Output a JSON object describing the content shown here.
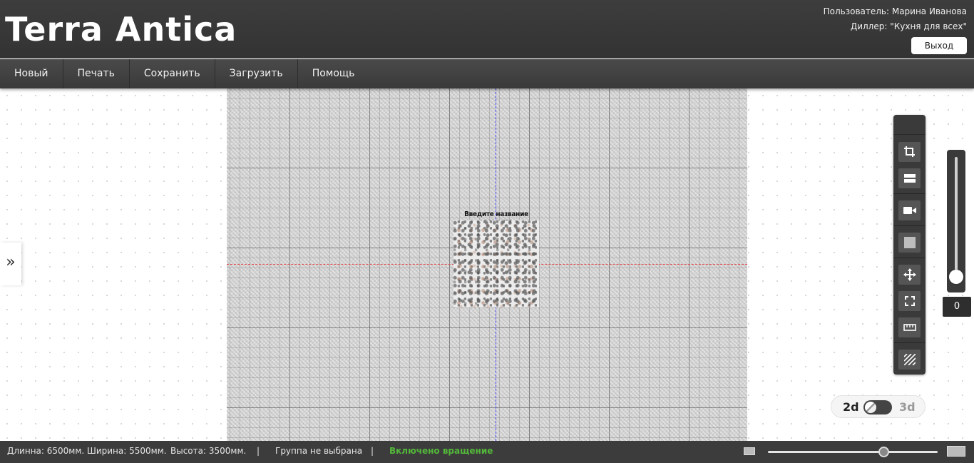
{
  "header": {
    "logo": "Terra Antica",
    "user_line": "Пользователь: Марина Иванова",
    "dealer_line": "Диллер: \"Кухня для всех\"",
    "logout_label": "Выход"
  },
  "menu": {
    "items": [
      {
        "label": "Новый"
      },
      {
        "label": "Печать"
      },
      {
        "label": "Сохранить"
      },
      {
        "label": "Загрузить"
      },
      {
        "label": "Помощь"
      }
    ]
  },
  "canvas": {
    "element_label": "Введите название элемента",
    "side_toggle": "»"
  },
  "tools": [
    {
      "icon": "crop-icon"
    },
    {
      "icon": "panel-icon"
    },
    {
      "icon": "camera-icon"
    },
    {
      "icon": "square-icon"
    },
    {
      "icon": "move-icon"
    },
    {
      "icon": "fit-screen-icon"
    },
    {
      "icon": "ruler-icon"
    },
    {
      "icon": "hatch-icon"
    }
  ],
  "height_slider": {
    "value": "0"
  },
  "view_switch": {
    "label_2d": "2d",
    "label_3d": "3d",
    "active": "2d"
  },
  "status": {
    "length": "Длинна: 6500мм.",
    "width": "Ширина: 5500мм.",
    "height": "Высота: 3500мм.",
    "sep1": "|",
    "group": "Группа не выбрана",
    "sep2": "|",
    "rotation": "Включено вращение"
  },
  "zoom": {
    "level": 0.68
  }
}
